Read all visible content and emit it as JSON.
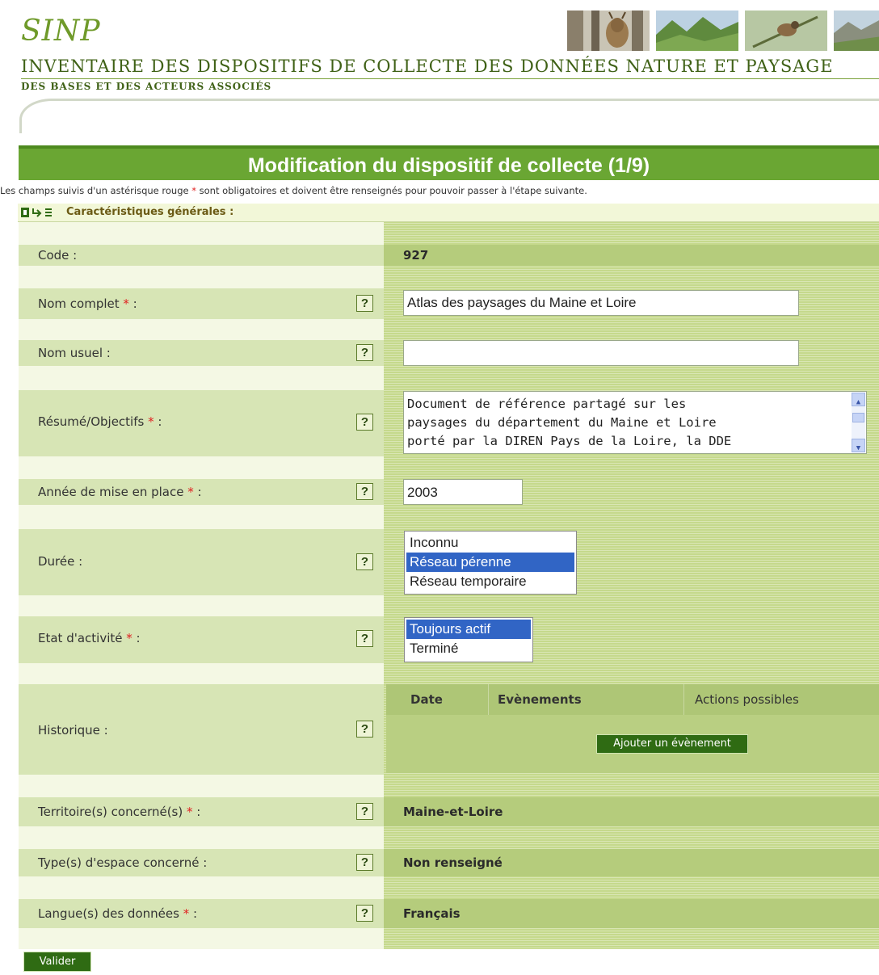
{
  "header": {
    "logo": "SINP",
    "title": "INVENTAIRE DES DISPOSITIFS DE COLLECTE DES DONNÉES NATURE ET PAYSAGE",
    "subtitle": "DES BASES ET DES ACTEURS ASSOCIÉS"
  },
  "page": {
    "banner_title": "Modification du dispositif de collecte (1/9)",
    "instructions_before": "Les champs suivis d'un astérisque rouge ",
    "instructions_star": "*",
    "instructions_after": " sont obligatoires et doivent être renseignés pour pouvoir passer à l'étape suivante.",
    "section_title": "Caractéristiques générales :"
  },
  "form": {
    "required_star": "*",
    "help_label": "?",
    "code": {
      "label": "Code :",
      "value": "927"
    },
    "nom_complet": {
      "label": "Nom complet",
      "suffix": " :",
      "value": "Atlas des paysages du Maine et Loire"
    },
    "nom_usuel": {
      "label": "Nom usuel :",
      "value": ""
    },
    "resume": {
      "label": "Résumé/Objectifs",
      "suffix": " :",
      "lines": [
        "Document de référence partagé sur les",
        "paysages du département du Maine et Loire",
        "porté par la DIREN Pays de la Loire, la DDE"
      ]
    },
    "annee": {
      "label": "Année de mise en place",
      "suffix": " :",
      "value": "2003"
    },
    "duree": {
      "label": "Durée :",
      "options": [
        "Inconnu",
        "Réseau pérenne",
        "Réseau temporaire"
      ],
      "selected": "Réseau pérenne"
    },
    "etat": {
      "label": "Etat d'activité",
      "suffix": " :",
      "options": [
        "Toujours actif",
        "Terminé"
      ],
      "selected": "Toujours actif"
    },
    "historique": {
      "label": "Historique :",
      "columns": [
        "Date",
        "Evènements",
        "Actions possibles"
      ],
      "add_button": "Ajouter un évènement"
    },
    "territoire": {
      "label": "Territoire(s) concerné(s)",
      "suffix": " :",
      "value": "Maine-et-Loire"
    },
    "type_espace": {
      "label": "Type(s) d'espace concerné :",
      "value": "Non renseigné"
    },
    "langue": {
      "label": "Langue(s) des données",
      "suffix": " :",
      "value": "Français"
    },
    "submit": "Valider"
  },
  "colors": {
    "banner_green": "#6aa633",
    "required_red": "#e02020",
    "selection_blue": "#3165c5",
    "button_green": "#2f6b13"
  }
}
